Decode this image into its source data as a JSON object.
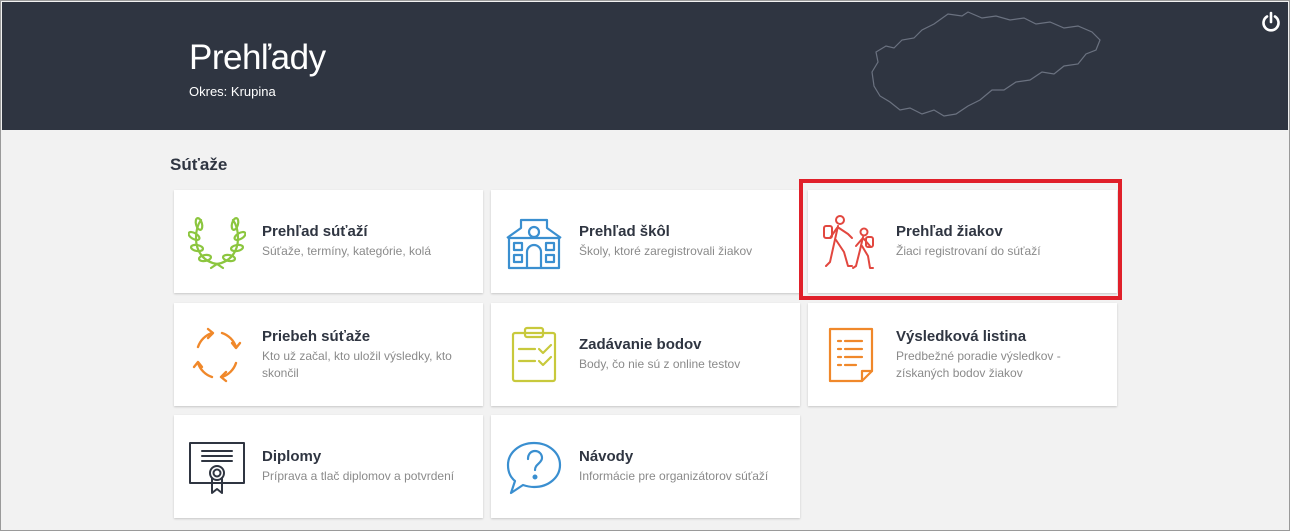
{
  "header": {
    "title": "Prehľady",
    "district": "Okres: Krupina",
    "background": "#2f3541"
  },
  "section": {
    "title": "Súťaže"
  },
  "cards": [
    {
      "title": "Prehľad súťaží",
      "description": "Súťaže, termíny, kategórie, kolá",
      "icon": "laurel-wreath-icon",
      "color": "#8cc63f"
    },
    {
      "title": "Prehľad škôl",
      "description": "Školy, ktoré zaregistrovali žiakov",
      "icon": "school-building-icon",
      "color": "#3a8fd0"
    },
    {
      "title": "Prehľad žiakov",
      "description": "Žiaci registrovaní do súťaží",
      "icon": "walking-students-icon",
      "color": "#e2473f"
    },
    {
      "title": "Priebeh súťaže",
      "description": "Kto už začal, kto uložil výsledky, kto skončil",
      "icon": "refresh-arrows-icon",
      "color": "#f0882a"
    },
    {
      "title": "Zadávanie bodov",
      "description": "Body, čo nie sú z online testov",
      "icon": "clipboard-check-icon",
      "color": "#c8c93c"
    },
    {
      "title": "Výsledková listina",
      "description": "Predbežné poradie výsledkov - získaných bodov žiakov",
      "icon": "results-document-icon",
      "color": "#f0882a"
    },
    {
      "title": "Diplomy",
      "description": "Príprava a tlač diplomov a potvrdení",
      "icon": "certificate-icon",
      "color": "#2f3541"
    },
    {
      "title": "Návody",
      "description": "Informácie pre organizátorov súťaží",
      "icon": "question-bubble-icon",
      "color": "#3a8fd0"
    }
  ],
  "highlight_color": "#e0202a"
}
